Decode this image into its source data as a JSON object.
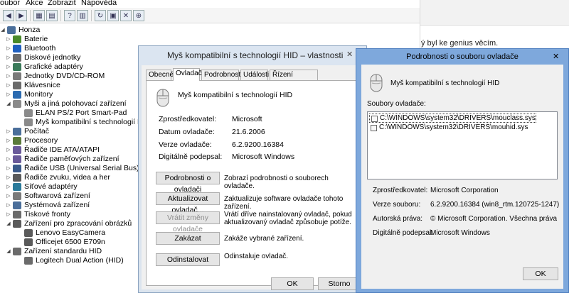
{
  "menu": {
    "items": [
      "oubor",
      "Akce",
      "Zobrazit",
      "Nápověda"
    ]
  },
  "tree": {
    "items": [
      {
        "label": "Honza",
        "level": 0,
        "arrow": "down",
        "icon": "computer-icon",
        "color": "#4a6e9a"
      },
      {
        "label": "Baterie",
        "level": 1,
        "arrow": "right",
        "icon": "battery-icon",
        "color": "#4a8a2a"
      },
      {
        "label": "Bluetooth",
        "level": 1,
        "arrow": "right",
        "icon": "bluetooth-icon",
        "color": "#1f5fbf"
      },
      {
        "label": "Diskové jednotky",
        "level": 1,
        "arrow": "right",
        "icon": "disk-icon",
        "color": "#6b6b6b"
      },
      {
        "label": "Grafické adaptéry",
        "level": 1,
        "arrow": "right",
        "icon": "display-adapter-icon",
        "color": "#3a7a5a"
      },
      {
        "label": "Jednotky DVD/CD-ROM",
        "level": 1,
        "arrow": "right",
        "icon": "dvd-icon",
        "color": "#7a7a7a"
      },
      {
        "label": "Klávesnice",
        "level": 1,
        "arrow": "right",
        "icon": "keyboard-icon",
        "color": "#6b6b6b"
      },
      {
        "label": "Monitory",
        "level": 1,
        "arrow": "right",
        "icon": "monitor-icon",
        "color": "#2a6ab0"
      },
      {
        "label": "Myši a jiná polohovací zařízení",
        "level": 1,
        "arrow": "down",
        "icon": "mouse-icon",
        "color": "#8a8a8a"
      },
      {
        "label": "ELAN PS/2 Port Smart-Pad",
        "level": 2,
        "arrow": "",
        "icon": "mouse-icon",
        "color": "#8a8a8a"
      },
      {
        "label": "Myš kompatibilní s technologií HID",
        "level": 2,
        "arrow": "",
        "icon": "mouse-icon",
        "color": "#8a8a8a"
      },
      {
        "label": "Počítač",
        "level": 1,
        "arrow": "right",
        "icon": "computer-icon",
        "color": "#4a6e9a"
      },
      {
        "label": "Procesory",
        "level": 1,
        "arrow": "right",
        "icon": "processor-icon",
        "color": "#5a7a3a"
      },
      {
        "label": "Řadiče IDE ATA/ATAPI",
        "level": 1,
        "arrow": "right",
        "icon": "ide-controller-icon",
        "color": "#6a5a9a"
      },
      {
        "label": "Řadiče paměťových zařízení",
        "level": 1,
        "arrow": "right",
        "icon": "storage-controller-icon",
        "color": "#6a5a9a"
      },
      {
        "label": "Řadiče USB (Universal Serial Bus)",
        "level": 1,
        "arrow": "right",
        "icon": "usb-icon",
        "color": "#3a5a8a"
      },
      {
        "label": "Řadiče zvuku, videa a her",
        "level": 1,
        "arrow": "right",
        "icon": "sound-icon",
        "color": "#5a5a5a"
      },
      {
        "label": "Síťové adaptéry",
        "level": 1,
        "arrow": "right",
        "icon": "network-icon",
        "color": "#2a7a9a"
      },
      {
        "label": "Softwarová zařízení",
        "level": 1,
        "arrow": "right",
        "icon": "software-device-icon",
        "color": "#7a7a7a"
      },
      {
        "label": "Systémová zařízení",
        "level": 1,
        "arrow": "right",
        "icon": "system-device-icon",
        "color": "#4a6e9a"
      },
      {
        "label": "Tiskové fronty",
        "level": 1,
        "arrow": "right",
        "icon": "printer-icon",
        "color": "#6b6b6b"
      },
      {
        "label": "Zařízení pro zpracování obrázků",
        "level": 1,
        "arrow": "down",
        "icon": "camera-icon",
        "color": "#5a5a5a"
      },
      {
        "label": "Lenovo EasyCamera",
        "level": 2,
        "arrow": "",
        "icon": "camera-icon",
        "color": "#5a5a5a"
      },
      {
        "label": "Officejet 6500 E709n",
        "level": 2,
        "arrow": "",
        "icon": "scanner-icon",
        "color": "#5a5a5a"
      },
      {
        "label": "Zařízení standardu HID",
        "level": 1,
        "arrow": "down",
        "icon": "hid-icon",
        "color": "#6b6b6b"
      },
      {
        "label": "Logitech Dual Action (HID)",
        "level": 2,
        "arrow": "",
        "icon": "gamepad-icon",
        "color": "#6b6b6b"
      }
    ]
  },
  "background": {
    "text": "ý byl ke genius věcím."
  },
  "props": {
    "title": "Myš kompatibilní s technologií HID – vlastnosti",
    "tabs": [
      "Obecné",
      "Ovladač",
      "Podrobnosti",
      "Události",
      "Řízení spotřeby"
    ],
    "active_tab": 1,
    "device_name": "Myš kompatibilní s technologií HID",
    "fields": [
      {
        "label": "Zprostředkovatel:",
        "value": "Microsoft"
      },
      {
        "label": "Datum ovladače:",
        "value": "21.6.2006"
      },
      {
        "label": "Verze ovladače:",
        "value": "6.2.9200.16384"
      },
      {
        "label": "Digitálně podepsal:",
        "value": "Microsoft Windows"
      }
    ],
    "actions": [
      {
        "button": "Podrobnosti o ovladači",
        "desc": [
          "Zobrazí podrobnosti o souborech ovladače."
        ],
        "disabled": false
      },
      {
        "button": "Aktualizovat ovladač...",
        "desc": [
          "Zaktualizuje software ovladače tohoto zařízení."
        ],
        "disabled": false
      },
      {
        "button": "Vrátit změny ovladače",
        "desc": [
          "Vrátí dříve nainstalovaný ovladač, pokud",
          "aktualizovaný ovladač způsobuje potíže."
        ],
        "disabled": true
      },
      {
        "button": "Zakázat",
        "desc": [
          "Zakáže vybrané zařízení."
        ],
        "disabled": false
      },
      {
        "button": "Odinstalovat",
        "desc": [
          "Odinstaluje ovladač."
        ],
        "disabled": false
      }
    ],
    "ok_label": "OK",
    "cancel_label": "Storno"
  },
  "details": {
    "title": "Podrobnosti o souboru ovladače",
    "device_name": "Myš kompatibilní s technologií HID",
    "files_label": "Soubory ovladače:",
    "files": [
      "C:\\WINDOWS\\system32\\DRIVERS\\mouclass.sys",
      "C:\\WINDOWS\\system32\\DRIVERS\\mouhid.sys"
    ],
    "fields": [
      {
        "label": "Zprostředkovatel:",
        "value": "Microsoft Corporation"
      },
      {
        "label": "Verze souboru:",
        "value": "6.2.9200.16384 (win8_rtm.120725-1247)"
      },
      {
        "label": "Autorská práva:",
        "value": "© Microsoft Corporation. Všechna práva"
      },
      {
        "label": "Digitálně podepsal:",
        "value": "Microsoft Windows"
      }
    ],
    "ok_label": "OK"
  }
}
